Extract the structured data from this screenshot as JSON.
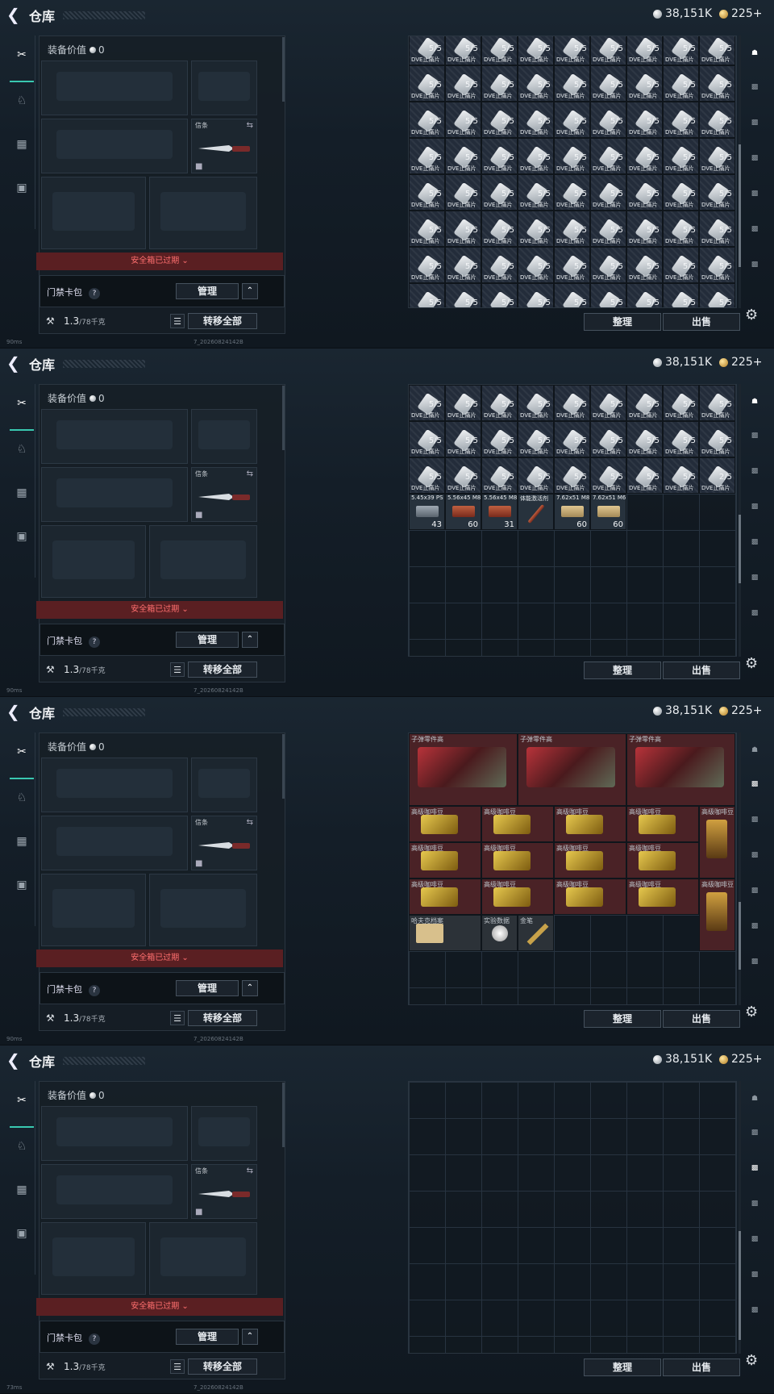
{
  "header": {
    "title": "仓库",
    "silver_value": "38,151K",
    "gold_value": "225+"
  },
  "equipment": {
    "value_label": "装备价值",
    "value": "0",
    "knife_slot_label": "信条",
    "safe_box_status": "安全箱已过期",
    "card_pack_label": "门禁卡包",
    "manage_label": "管理",
    "weight_current": "1.3",
    "weight_max": "/78千克",
    "transfer_all_label": "转移全部"
  },
  "storage": {
    "sort_label": "整理",
    "sell_label": "出售"
  },
  "screens": [
    {
      "status_ping": "90ms",
      "build_id": "7_20260824142B",
      "scroll_thumb": {
        "top": 0.4,
        "length": 0.45
      },
      "active_right_tab": 0,
      "items": "med_full"
    },
    {
      "status_ping": "90ms",
      "build_id": "7_20260824142B",
      "scroll_thumb": {
        "top": 0.48,
        "length": 0.25
      },
      "active_right_tab": 0,
      "items": "med_tail"
    },
    {
      "status_ping": "90ms",
      "build_id": "7_20260824142B",
      "scroll_thumb": {
        "top": 0.62,
        "length": 0.25
      },
      "active_right_tab": 1,
      "items": "valuables"
    },
    {
      "status_ping": "73ms",
      "build_id": "7_20260824142B",
      "scroll_thumb": {
        "top": 0.55,
        "length": 0.4
      },
      "active_right_tab": 2,
      "items": "empty"
    }
  ],
  "item_text": {
    "med_label": "DVE止痛片",
    "med_count": "5/5",
    "med_partial": "2/5",
    "ammo": [
      {
        "label": "5.45x39 PS",
        "count": "43",
        "kind": "gray"
      },
      {
        "label": "5.56x45 M855",
        "count": "60",
        "kind": "red"
      },
      {
        "label": "5.56x45 M856",
        "count": "31",
        "kind": "red"
      },
      {
        "label": "体能激活剂",
        "count": "",
        "kind": "syringe"
      },
      {
        "label": "7.62x51 M80",
        "count": "60",
        "kind": "tan"
      },
      {
        "label": "7.62x51 M62",
        "count": "60",
        "kind": "tan"
      }
    ],
    "bullet_parts": "子弹零件高",
    "coffee": "高级咖啡豆",
    "docs": "哈夫克档案",
    "lab_data": "实验数据",
    "gold_pen": "金笔"
  },
  "icons": {
    "back": "back-arrow-icon",
    "silver": "silver-coin-icon",
    "gold": "gold-coin-icon",
    "gear": "gear-icon"
  },
  "colors": {
    "accent": "#39c8b0",
    "warning": "#ff6f6f"
  }
}
